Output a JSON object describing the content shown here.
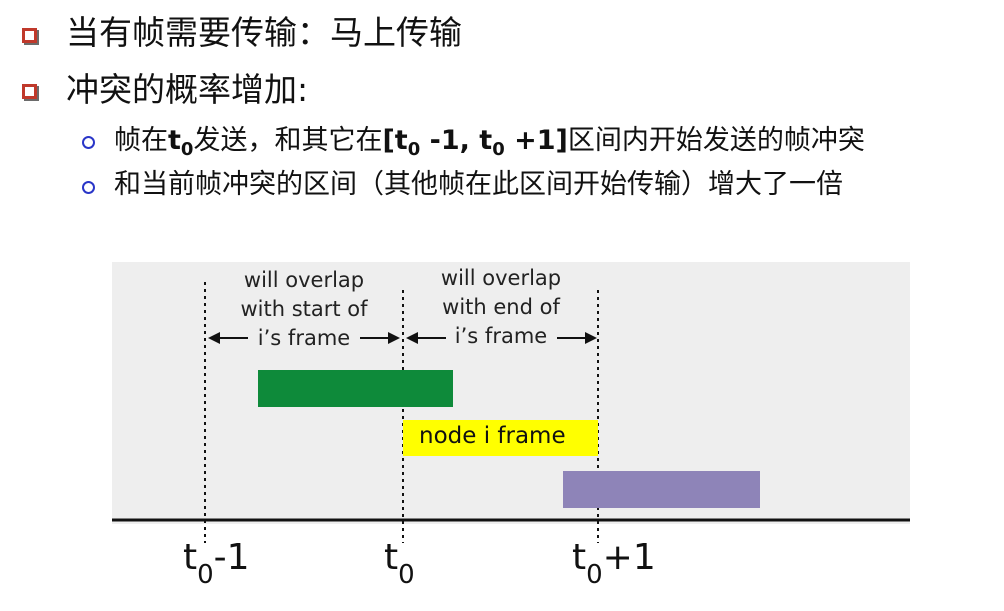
{
  "bullets": [
    {
      "text": "当有帧需要传输：马上传输"
    },
    {
      "text": "冲突的概率增加:"
    }
  ],
  "sub_bullets": [
    {
      "pre": "帧在",
      "t": "t",
      "t_sub": "0",
      "mid": "发送，和其它在",
      "range": "[t",
      "range_sub1": "0",
      "range_mid": " -1, t",
      "range_sub2": "0",
      "range_end": " +1]",
      "post": "区间内开始发送的帧冲突"
    },
    {
      "text": "和当前帧冲突的区间（其他帧在此区间开始传输）增大了一倍"
    }
  ],
  "diagram": {
    "annotation_left": [
      "will overlap",
      "with start of",
      "i’s frame"
    ],
    "annotation_right": [
      "will overlap",
      "with end of",
      "i’s frame"
    ],
    "node_frame_label": "node i frame",
    "time_labels": [
      {
        "main": "t",
        "sub": "0",
        "suffix": "-1"
      },
      {
        "main": "t",
        "sub": "0",
        "suffix": ""
      },
      {
        "main": "t",
        "sub": "0",
        "suffix": "+1"
      }
    ],
    "colors": {
      "panel": "#eeeeee",
      "green_frame": "#0e8a3a",
      "yellow_frame": "#ffff00",
      "purple_frame": "#8e84b8",
      "axis": "#111111"
    }
  }
}
